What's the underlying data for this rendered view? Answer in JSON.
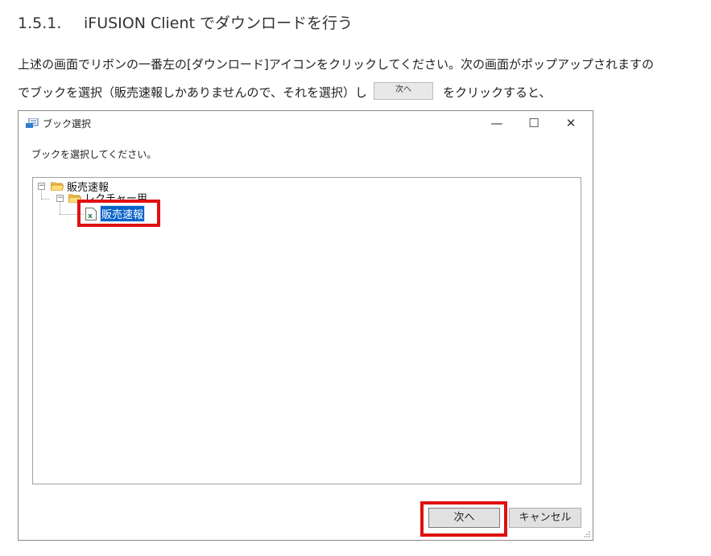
{
  "document": {
    "section_number": "1.5.1.",
    "section_title": "iFUSION Client でダウンロードを行う",
    "paragraph_line1": "上述の画面でリボンの一番左の[ダウンロード]アイコンをクリックしてください。次の画面がポップアップされますの",
    "paragraph_line2_before": "でブックを選択（販売速報しかありませんので、それを選択）し",
    "inline_button_label": "次へ",
    "paragraph_line2_after": "をクリックすると、"
  },
  "dialog": {
    "title": "ブック選択",
    "minimize_glyph": "—",
    "maximize_glyph": "☐",
    "close_glyph": "✕",
    "prompt": "ブックを選択してください。",
    "tree": {
      "root_toggle": "−",
      "root_label": "販売速報",
      "child_toggle": "−",
      "child_label": "レクチャー用",
      "leaf_label": "販売速報"
    },
    "next_button": "次へ",
    "cancel_button": "キャンセル"
  },
  "colors": {
    "highlight": "#e01010",
    "selection": "#0a63c9"
  },
  "icons": [
    "book-select-icon",
    "folder-icon",
    "excel-file-icon"
  ]
}
